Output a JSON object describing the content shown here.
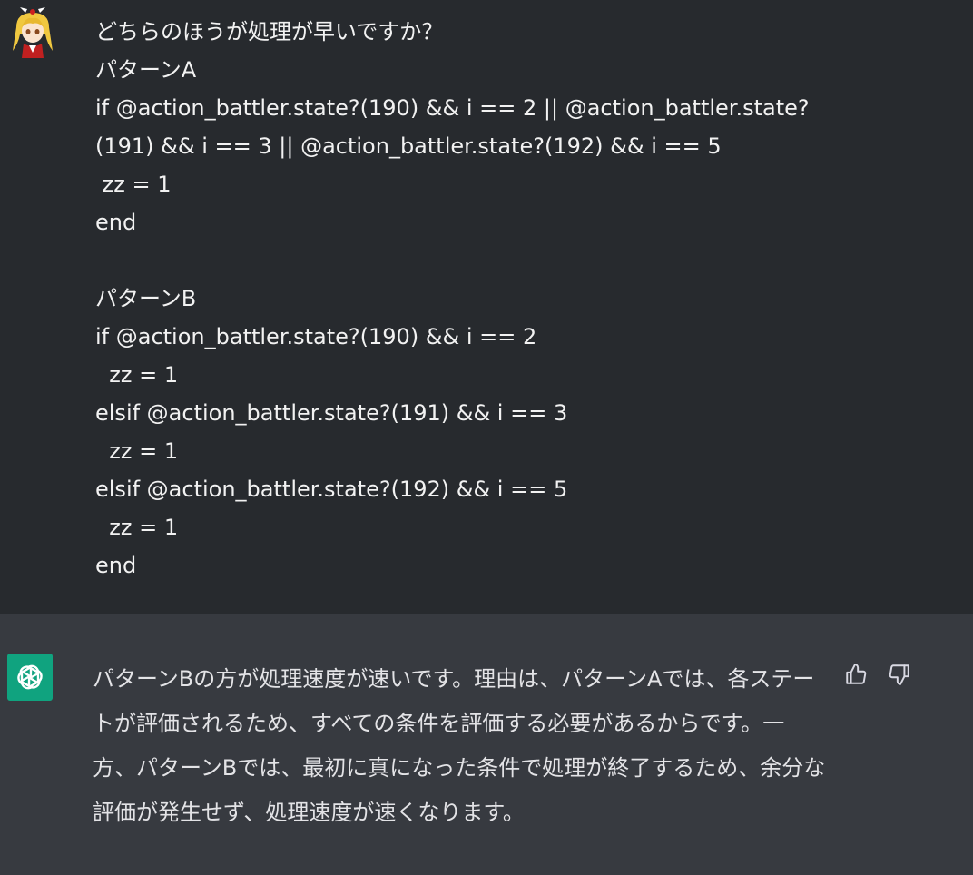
{
  "user_message": {
    "avatar": "anime-character-avatar",
    "lines": [
      "どちらのほうが処理が早いですか？",
      "パターンA",
      "if @action_battler.state?(190) && i == 2 || @action_battler.state?",
      "(191) && i == 3 || @action_battler.state?(192) && i == 5",
      " zz = 1",
      "end",
      "",
      "パターンB",
      "if @action_battler.state?(190) && i == 2",
      "  zz = 1",
      "elsif @action_battler.state?(191) && i == 3",
      "  zz = 1",
      "elsif @action_battler.state?(192) && i == 5",
      "  zz = 1",
      "end"
    ]
  },
  "assistant_message": {
    "avatar": "openai-logo-icon",
    "text": "パターンBの方が処理速度が速いです。理由は、パターンAでは、各ステートが評価されるため、すべての条件を評価する必要があるからです。一方、パターンBでは、最初に真になった条件で処理が終了するため、余分な評価が発生せず、処理速度が速くなります。"
  },
  "feedback": {
    "up_icon": "thumbs-up-icon",
    "down_icon": "thumbs-down-icon"
  },
  "colors": {
    "user_bg": "#272a2e",
    "assistant_bg": "#373a40",
    "gpt_green": "#10a37f"
  }
}
